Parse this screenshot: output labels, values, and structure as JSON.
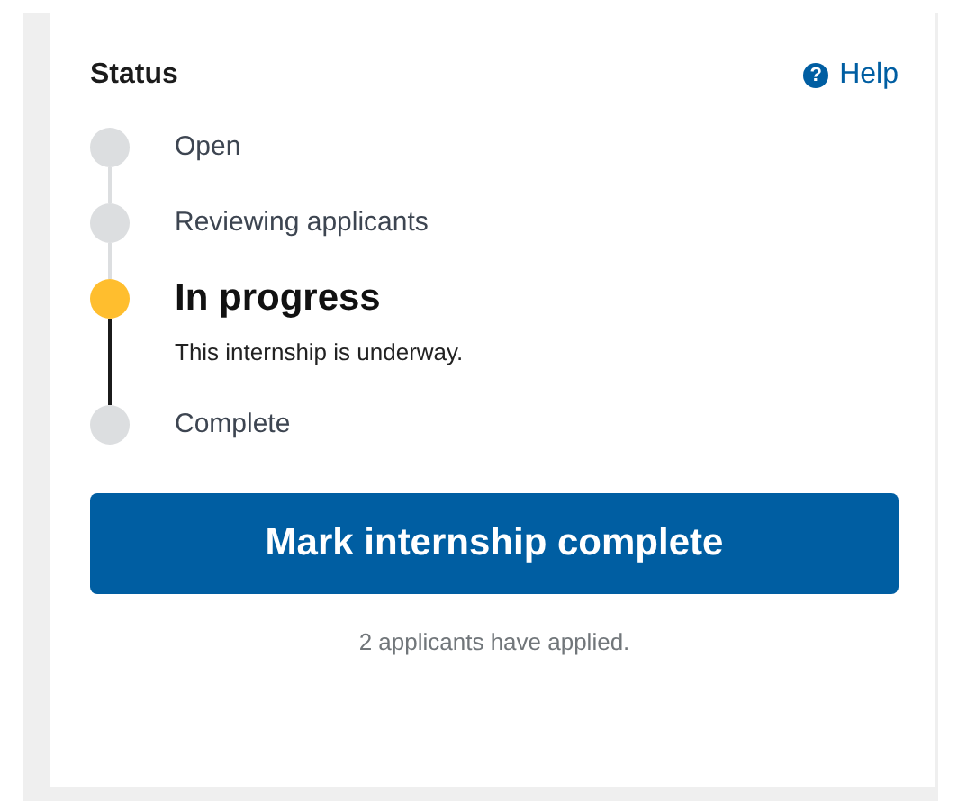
{
  "card": {
    "title": "Status",
    "help": {
      "icon": "?",
      "label": "Help"
    }
  },
  "steps": [
    {
      "label": "Open",
      "current": false
    },
    {
      "label": "Reviewing applicants",
      "current": false
    },
    {
      "label": "In progress",
      "current": true,
      "description": "This internship is underway."
    },
    {
      "label": "Complete",
      "current": false
    }
  ],
  "button": "Mark internship complete",
  "note": "2 applicants have applied."
}
